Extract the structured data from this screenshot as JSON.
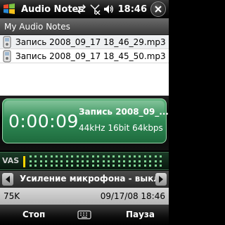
{
  "titlebar": {
    "title": "Audio Notes",
    "time": "18:46",
    "icons": [
      "windows-logo",
      "connectivity-icon",
      "no-signal-icon",
      "volume-icon",
      "ok-icon"
    ]
  },
  "list": {
    "header": "My Audio Notes",
    "files": [
      {
        "name": "Запись 2008_09_17 18_46_29.mp3"
      },
      {
        "name": "Запись 2008_09_17 18_45_50.mp3"
      }
    ]
  },
  "display": {
    "time": "0:00:09",
    "recording_name": "Запись 2008_09_...",
    "recording_info": "44kHz 16bit 64kbps"
  },
  "vas": {
    "label": "VAS",
    "level": 0
  },
  "selector": {
    "text": "Усиление микрофона - выкл"
  },
  "info": {
    "size": "75K",
    "date": "09/17/08 18:46"
  },
  "softkeys": {
    "left": "Стоп",
    "right": "Пауза"
  },
  "colors": {
    "display_green": "#2f8a55",
    "vas_marker": "#ffd400",
    "level_green": "#7fd493"
  }
}
